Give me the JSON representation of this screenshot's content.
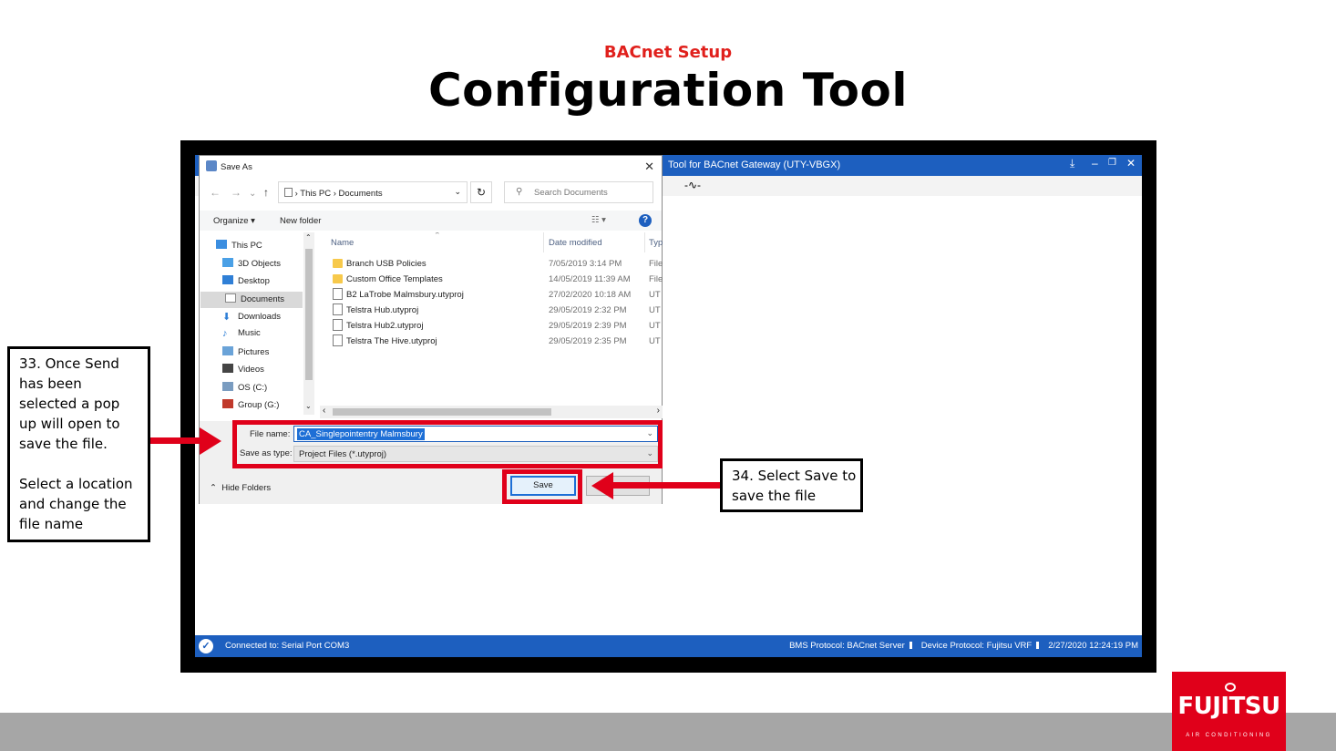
{
  "slide": {
    "subtitle": "BACnet Setup",
    "title": "Configuration Tool",
    "logo_text": "FUJITSU",
    "logo_tagline": "AIR CONDITIONING"
  },
  "app": {
    "title": "Tool for BACnet Gateway (UTY-VBGX)",
    "controls": [
      "⤓",
      "–",
      "🗗",
      "✕"
    ],
    "status_left": "Connected to: Serial Port COM3",
    "status_bms": "BMS Protocol: BACnet Server",
    "status_device": "Device Protocol: Fujitsu VRF",
    "status_time": "2/27/2020 12:24:19 PM"
  },
  "dialog": {
    "title": "Save As",
    "address": [
      "This PC",
      "Documents"
    ],
    "search_placeholder": "Search Documents",
    "organize": "Organize ▾",
    "new_folder": "New folder",
    "nav_items": [
      {
        "label": "This PC",
        "icon": "computer-icon",
        "color": "#3b8ee0"
      },
      {
        "label": "3D Objects",
        "icon": "cube-icon",
        "color": "#4aa0e6"
      },
      {
        "label": "Desktop",
        "icon": "desktop-icon",
        "color": "#2f7fd6"
      },
      {
        "label": "Documents",
        "icon": "documents-icon",
        "color": "#8a8a8a"
      },
      {
        "label": "Downloads",
        "icon": "download-icon",
        "color": "#2f7fd6"
      },
      {
        "label": "Music",
        "icon": "music-icon",
        "color": "#2f7fd6"
      },
      {
        "label": "Pictures",
        "icon": "pictures-icon",
        "color": "#6aa3d8"
      },
      {
        "label": "Videos",
        "icon": "videos-icon",
        "color": "#444444"
      },
      {
        "label": "OS (C:)",
        "icon": "drive-icon",
        "color": "#7a9cc0"
      },
      {
        "label": "Group (G:)",
        "icon": "network-drive-icon",
        "color": "#c0392b"
      }
    ],
    "columns": {
      "name": "Name",
      "date": "Date modified",
      "type": "Typ"
    },
    "files": [
      {
        "name": "Branch USB Policies",
        "date": "7/05/2019 3:14 PM",
        "type": "File",
        "kind": "folder"
      },
      {
        "name": "Custom Office Templates",
        "date": "14/05/2019 11:39 AM",
        "type": "File",
        "kind": "folder"
      },
      {
        "name": "B2 LaTrobe Malmsbury.utyproj",
        "date": "27/02/2020 10:18 AM",
        "type": "UT",
        "kind": "file"
      },
      {
        "name": "Telstra Hub.utyproj",
        "date": "29/05/2019 2:32 PM",
        "type": "UT",
        "kind": "file"
      },
      {
        "name": "Telstra Hub2.utyproj",
        "date": "29/05/2019 2:39 PM",
        "type": "UT",
        "kind": "file"
      },
      {
        "name": "Telstra The Hive.utyproj",
        "date": "29/05/2019 2:35 PM",
        "type": "UT",
        "kind": "file"
      }
    ],
    "file_name_label": "File name:",
    "file_name_value": "CA_Singlepointentry Malmsbury",
    "save_type_label": "Save as type:",
    "save_type_value": "Project Files (*.utyproj)",
    "hide_folders": "Hide Folders",
    "save_button": "Save"
  },
  "callouts": {
    "left_lines": [
      "33. Once Send",
      "has been",
      "selected a pop",
      "up will open to",
      "save the file.",
      "",
      "Select a location",
      "and change the",
      "file name"
    ],
    "right_lines": [
      "34. Select Save to",
      "save the file"
    ]
  },
  "colors": {
    "accent_red": "#e0001a",
    "title_blue": "#1d5fbf"
  }
}
